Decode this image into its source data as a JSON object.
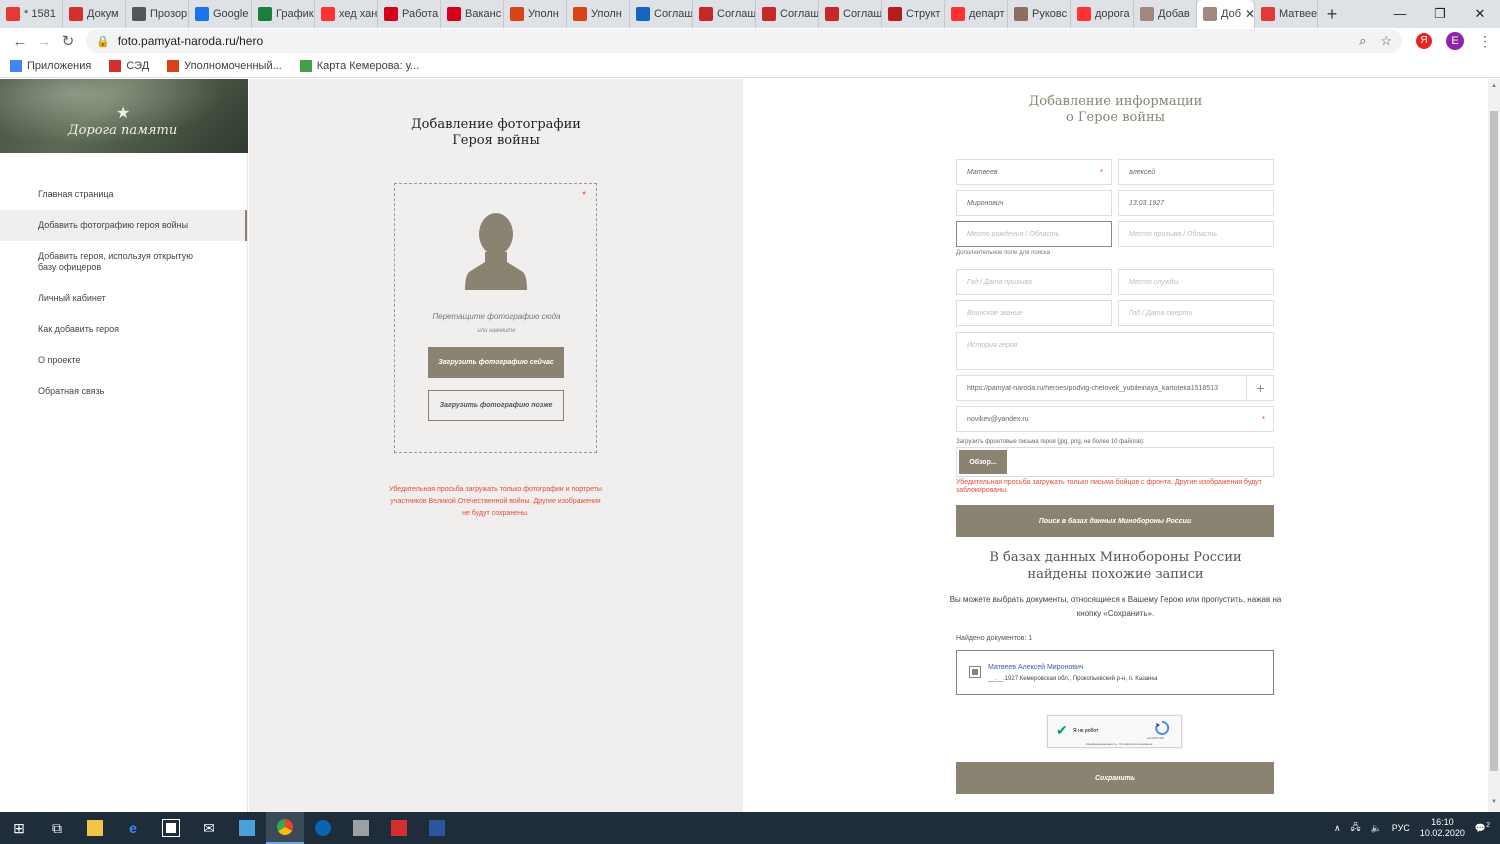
{
  "browser": {
    "tabs": [
      {
        "label": "* 1581",
        "color": "#e53935"
      },
      {
        "label": "Докум",
        "color": "#d32f2f"
      },
      {
        "label": "Прозор",
        "color": "#555555"
      },
      {
        "label": "Google",
        "color": "#1a73e8"
      },
      {
        "label": "График",
        "color": "#188038"
      },
      {
        "label": "хед хан",
        "color": "#ff3333"
      },
      {
        "label": "Работа",
        "color": "#d6001c"
      },
      {
        "label": "Ваканс",
        "color": "#d6001c"
      },
      {
        "label": "Уполн",
        "color": "#d84315"
      },
      {
        "label": "Уполн",
        "color": "#d84315"
      },
      {
        "label": "Соглаш",
        "color": "#1565c0"
      },
      {
        "label": "Соглаш",
        "color": "#c62828"
      },
      {
        "label": "Соглаш",
        "color": "#c62828"
      },
      {
        "label": "Соглаш",
        "color": "#c62828"
      },
      {
        "label": "Структ",
        "color": "#b71c1c"
      },
      {
        "label": "департ",
        "color": "#ff3333"
      },
      {
        "label": "Руковс",
        "color": "#8d6e63"
      },
      {
        "label": "дорога",
        "color": "#ff3333"
      },
      {
        "label": "Добав",
        "color": "#a1887f"
      },
      {
        "label": "Доб",
        "color": "#a1887f",
        "active": true
      },
      {
        "label": "Матвее",
        "color": "#e53935"
      }
    ],
    "new_tab": "+",
    "url": "foto.pamyat-naroda.ru/hero",
    "window_controls": [
      "—",
      "❐",
      "✕"
    ],
    "extension_initial": "Я",
    "profile_initial": "E",
    "bookmarks": [
      {
        "label": "Приложения",
        "color": "#4285f4"
      },
      {
        "label": "СЭД",
        "color": "#d32f2f"
      },
      {
        "label": "Уполномоченный...",
        "color": "#d84315"
      },
      {
        "label": "Карта Кемерова: у...",
        "color": "#43a047"
      }
    ]
  },
  "sidebar": {
    "logo_text": "Дорога памяти",
    "menu": [
      {
        "label": "Главная страница"
      },
      {
        "label": "Добавить фотографию героя войны",
        "active": true
      },
      {
        "label": "Добавить героя, используя открытую базу офицеров"
      },
      {
        "label": "Личный кабинет"
      },
      {
        "label": "Как добавить героя"
      },
      {
        "label": "О проекте"
      },
      {
        "label": "Обратная связь"
      }
    ]
  },
  "photo_panel": {
    "title_line1": "Добавление фотографии",
    "title_line2": "Героя войны",
    "required_mark": "*",
    "drop_text": "Перетащите фотографию сюда",
    "drop_or": "или нажмите",
    "upload_now_label": "Загрузить фотографию сейчас",
    "upload_later_label": "Загрузить фотографию позже",
    "warning": "Убедительная просьба загружать только фотографии и портреты участников Великой Отечественной войны. Другие изображения не будут сохранены."
  },
  "form": {
    "title_line1": "Добавление информации",
    "title_line2": "о Герое войны",
    "surname": {
      "value": "Матвеев"
    },
    "name": {
      "value": "алексей"
    },
    "patronymic": {
      "value": "Миронович"
    },
    "birth_date": {
      "value": "13.03.1927"
    },
    "birth_place": {
      "placeholder": "Место рождения / Область"
    },
    "draft_place": {
      "placeholder": "Место призыва / Область"
    },
    "extra_hint": "Дополнительное поле для поиска",
    "draft_year": {
      "placeholder": "Год / Дата призыва"
    },
    "service_place": {
      "placeholder": "Место службы"
    },
    "rank": {
      "placeholder": "Воинское звание"
    },
    "death_date": {
      "placeholder": "Год / Дата смерти"
    },
    "history": {
      "placeholder": "История героя"
    },
    "link": {
      "value": "https://pamyat-naroda.ru/heroes/podvig-chelovek_yubileinaya_kartoteka1518513"
    },
    "plus": "+",
    "email": {
      "value": "novikev@yandex.ru"
    },
    "required_mark": "*",
    "upload_label": "Загрузить фронтовые письма героя (jpg, png, не более 10 файлов):",
    "browse_label": "Обзор...",
    "letters_warning": "Убедительная просьба загружать только письма бойцов с фронта. Другие изображения будут заблокированы.",
    "search_button": "Поиск в базах данных Минобороны России"
  },
  "results": {
    "title_line1": "В базах данных Минобороны России",
    "title_line2": "найдены похожие записи",
    "description": "Вы можете выбрать документы, относящиеся к Вашему Герою или пропустить, нажав на кнопку «Сохранить».",
    "found_count_label": "Найдено документов: 1",
    "items": [
      {
        "name": "Матвеев Алексей Миронович",
        "info": "__.__.1927 Кемеровская обл., Прокопьевский р-н, п. Казанка"
      }
    ],
    "captcha_label": "Я не робот",
    "captcha_brand": "reCAPTCHA",
    "captcha_privacy": "Конфиденциальность - Условия использования",
    "save_button": "Сохранить"
  },
  "taskbar": {
    "tray_lang": "РУС",
    "time": "16:10",
    "date": "10.02.2020",
    "notifications": "2"
  }
}
